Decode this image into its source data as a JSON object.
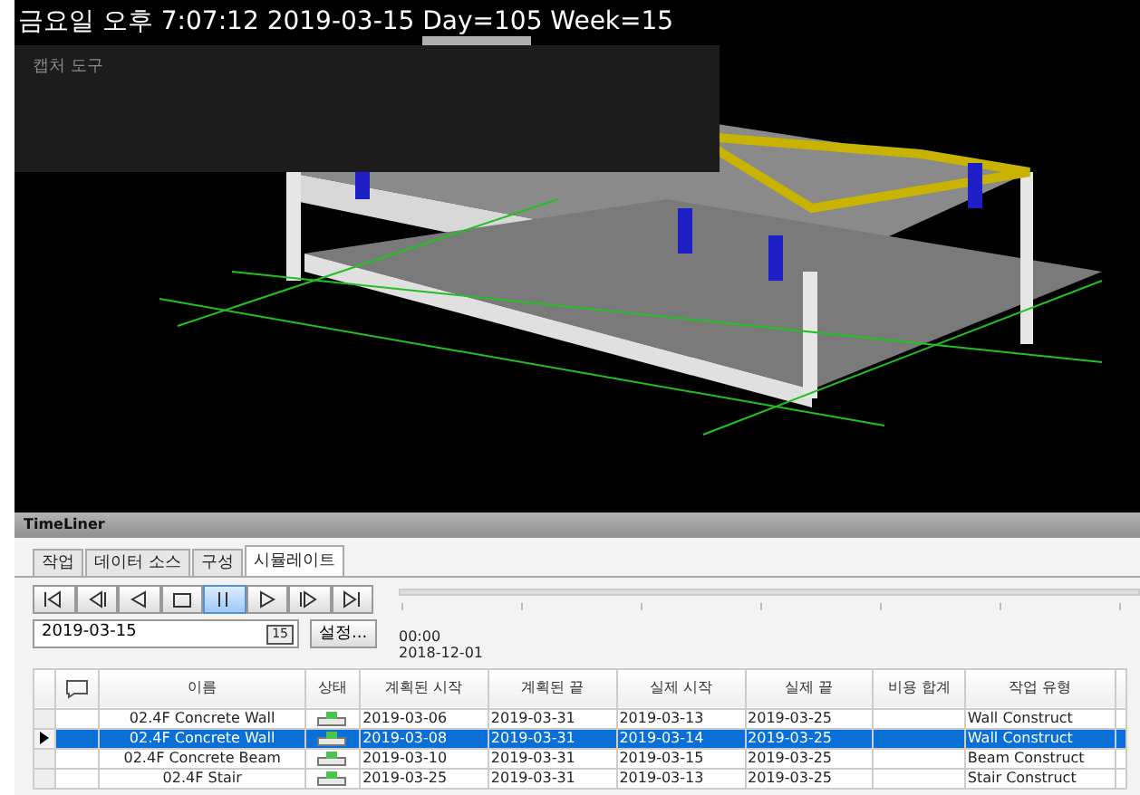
{
  "viewport": {
    "overlay_text": "금요일 오후 7:07:12 2019-03-15 Day=105 Week=15",
    "panel_text": "캡처 도구"
  },
  "timeliner": {
    "title": "TimeLiner",
    "tabs": [
      {
        "label": "작업",
        "selected": false
      },
      {
        "label": "데이터 소스",
        "selected": false
      },
      {
        "label": "구성",
        "selected": false
      },
      {
        "label": "시뮬레이트",
        "selected": true
      }
    ],
    "playback_buttons": [
      {
        "kind": "first",
        "selected": false
      },
      {
        "kind": "step-back",
        "selected": false
      },
      {
        "kind": "play-back",
        "selected": false
      },
      {
        "kind": "stop",
        "selected": false
      },
      {
        "kind": "pause",
        "selected": true
      },
      {
        "kind": "play",
        "selected": false
      },
      {
        "kind": "step-forward",
        "selected": false
      },
      {
        "kind": "last",
        "selected": false
      }
    ],
    "date_field": {
      "value": "2019-03-15",
      "calendar_label": "15"
    },
    "settings_button": "설정...",
    "time_readout": [
      "00:00",
      "2018-12-01"
    ],
    "table": {
      "columns": [
        "이름",
        "상태",
        "계획된 시작",
        "계획된 끝",
        "실제 시작",
        "실제 끝",
        "비용 합계",
        "작업 유형"
      ],
      "rows": [
        {
          "selected": false,
          "cells": [
            "02.4F Concrete Wall",
            "",
            "2019-03-06",
            "2019-03-31",
            "2019-03-13",
            "2019-03-25",
            "",
            "Wall Construct"
          ]
        },
        {
          "selected": true,
          "cells": [
            "02.4F Concrete Wall",
            "",
            "2019-03-08",
            "2019-03-31",
            "2019-03-14",
            "2019-03-25",
            "",
            "Wall Construct"
          ]
        },
        {
          "selected": false,
          "cells": [
            "02.4F Concrete Beam",
            "",
            "2019-03-10",
            "2019-03-31",
            "2019-03-15",
            "2019-03-25",
            "",
            "Beam Construct"
          ]
        },
        {
          "selected": false,
          "cells": [
            "02.4F Stair",
            "",
            "2019-03-25",
            "2019-03-31",
            "2019-03-13",
            "2019-03-25",
            "",
            "Stair Construct"
          ]
        }
      ]
    }
  }
}
